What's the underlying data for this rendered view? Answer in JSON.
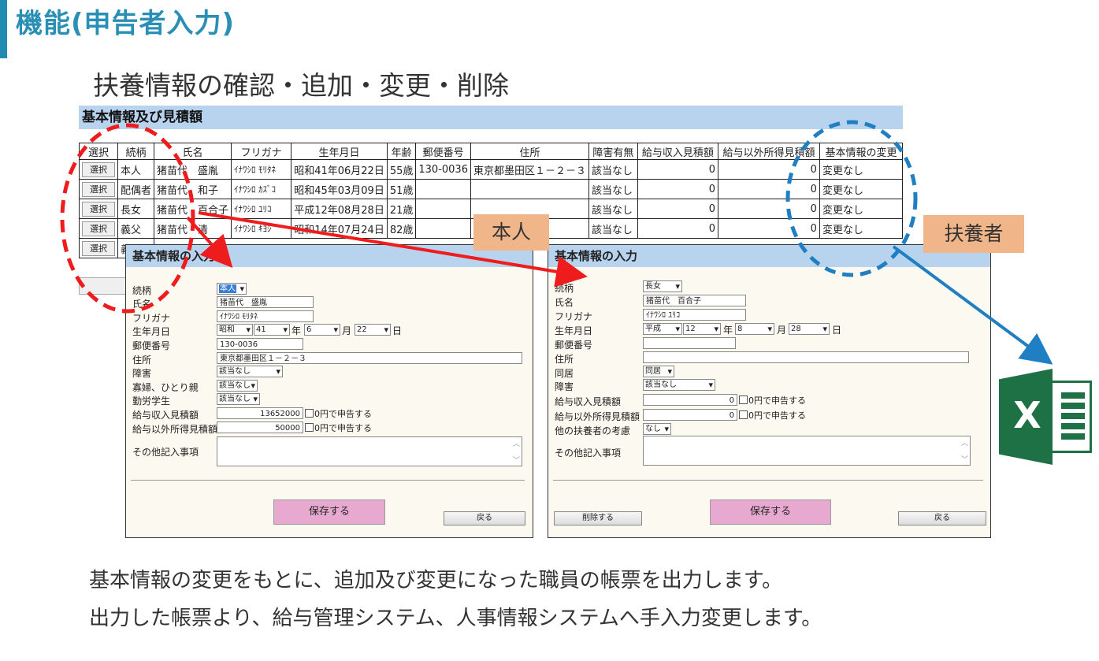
{
  "slide": {
    "title": "機能(申告者入力)",
    "subtitle": "扶養情報の確認・追加・変更・削除",
    "desc_line1": "基本情報の変更をもとに、追加及び変更になった職員の帳票を出力します。",
    "desc_line2": "出力した帳票より、給与管理システム、人事情報システムへ手入力変更します。",
    "tag_self": "本人",
    "tag_dependent": "扶養者",
    "excel_icon_letter": "X"
  },
  "top_panel": {
    "header": "基本情報及び見積額",
    "columns": [
      "選択",
      "続柄",
      "氏名",
      "フリガナ",
      "生年月日",
      "年齢",
      "郵便番号",
      "住所",
      "障害有無",
      "給与収入見積額",
      "給与以外所得見積額",
      "基本情報の変更"
    ],
    "select_label": "選択",
    "rows": [
      {
        "relation": "本人",
        "name": "猪苗代　盛胤",
        "kana": "ｲﾅﾜｼﾛ ﾓﾘﾀﾈ",
        "birth": "昭和41年06月22日",
        "age": "55歳",
        "zip": "130-0036",
        "address": "東京都墨田区１－２－３",
        "disability": "該当なし",
        "salary": "0",
        "other": "0",
        "change": "変更なし"
      },
      {
        "relation": "配偶者",
        "name": "猪苗代　和子",
        "kana": "ｲﾅﾜｼﾛ ｶｽﾞｺ",
        "birth": "昭和45年03月09日",
        "age": "51歳",
        "zip": "",
        "address": "",
        "disability": "該当なし",
        "salary": "0",
        "other": "0",
        "change": "変更なし"
      },
      {
        "relation": "長女",
        "name": "猪苗代　百合子",
        "kana": "ｲﾅﾜｼﾛ ﾕﾘｺ",
        "birth": "平成12年08月28日",
        "age": "21歳",
        "zip": "",
        "address": "",
        "disability": "該当なし",
        "salary": "0",
        "other": "0",
        "change": "変更なし"
      },
      {
        "relation": "義父",
        "name": "猪苗代　清",
        "kana": "ｲﾅﾜｼﾛ ｷﾖｼ",
        "birth": "昭和14年07月24日",
        "age": "82歳",
        "zip": "",
        "address": "",
        "disability": "該当なし",
        "salary": "0",
        "other": "0",
        "change": "変更なし"
      },
      {
        "relation": "義",
        "name": "",
        "kana": "",
        "birth": "",
        "age": "",
        "zip": "",
        "address": "",
        "disability": "",
        "salary": "",
        "other": "",
        "change": ""
      }
    ]
  },
  "self_dialog": {
    "header": "基本情報の入力",
    "relation_label": "続柄",
    "relation_value": "本人",
    "name_label": "氏名",
    "name_value": "猪苗代　盛胤",
    "kana_label": "フリガナ",
    "kana_value": "ｲﾅﾜｼﾛ ﾓﾘﾀﾈ",
    "birth_label": "生年月日",
    "era": "昭和",
    "year": "41",
    "year_unit": "年",
    "month": "6",
    "month_unit": "月",
    "day": "22",
    "day_unit": "日",
    "zip_label": "郵便番号",
    "zip_value": "130-0036",
    "address_label": "住所",
    "address_value": "東京都墨田区１－２－３",
    "disability_label": "障害",
    "disability_value": "該当なし",
    "widow_label": "寡婦、ひとり親",
    "widow_value": "該当なし",
    "student_label": "勤労学生",
    "student_value": "該当なし",
    "salary_label": "給与収入見積額",
    "salary_value": "13652000",
    "zero_declare": "0円で申告する",
    "other_label": "給与以外所得見積額",
    "other_value": "50000",
    "notes_label": "その他記入事項",
    "save_label": "保存する",
    "back_label": "戻る"
  },
  "dep_dialog": {
    "header": "基本情報の入力",
    "relation_label": "続柄",
    "relation_value": "長女",
    "name_label": "氏名",
    "name_value": "猪苗代　百合子",
    "kana_label": "フリガナ",
    "kana_value": "ｲﾅﾜｼﾛ ﾕﾘｺ",
    "birth_label": "生年月日",
    "era": "平成",
    "year": "12",
    "year_unit": "年",
    "month": "8",
    "month_unit": "月",
    "day": "28",
    "day_unit": "日",
    "zip_label": "郵便番号",
    "zip_value": "",
    "address_label": "住所",
    "address_value": "",
    "cohabit_label": "同居",
    "cohabit_value": "同居",
    "disability_label": "障害",
    "disability_value": "該当なし",
    "salary_label": "給与収入見積額",
    "salary_value": "0",
    "zero_declare": "0円で申告する",
    "other_label": "給与以外所得見積額",
    "other_value": "0",
    "consider_label": "他の扶養者の考慮",
    "consider_value": "なし",
    "notes_label": "その他記入事項",
    "delete_label": "削除する",
    "save_label": "保存する",
    "back_label": "戻る"
  },
  "colors": {
    "accent": "#2a8fb5",
    "header_bg": "#b8d3ee",
    "dialog_bg": "#fcfaf0",
    "save_btn": "#e7a9cf",
    "tag_bg": "#f0b68a",
    "red_arrow": "#ee1c1c",
    "blue_arrow": "#1f7fc2",
    "excel_green": "#1e7145"
  }
}
